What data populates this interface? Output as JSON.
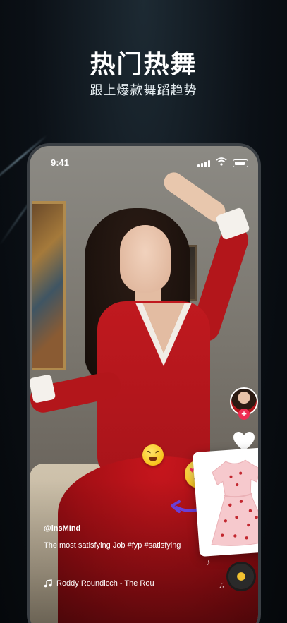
{
  "promo": {
    "headline": "热门热舞",
    "subline": "跟上爆款舞蹈趋势"
  },
  "status_bar": {
    "time": "9:41"
  },
  "video": {
    "username": "@insMInd",
    "caption": "The most satisfying Job #fyp #satisfying",
    "music": "Roddy Roundicch - The Rou",
    "follow_symbol": "+"
  },
  "colors": {
    "accent": "#ee2d52",
    "dress_red": "#b3161b",
    "arrow_purple": "#6a3fd8"
  },
  "icons": [
    "signal-icon",
    "wifi-icon",
    "battery-icon",
    "heart-icon",
    "music-note-icon",
    "music-disc-icon",
    "arrow-icon"
  ]
}
